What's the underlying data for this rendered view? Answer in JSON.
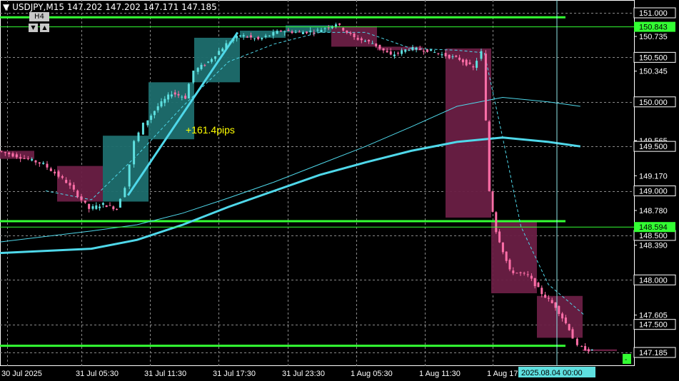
{
  "header": {
    "menu_glyph": "▼",
    "symbol_timeframe": "USDJPY,M15",
    "ohlc": "147.202 147.202 147.171 147.185"
  },
  "timeframe_badge": "H4",
  "timeframe_arrows": [
    "▼",
    "▲"
  ],
  "annotation": {
    "text": "+161.4pips",
    "color": "#ffff00"
  },
  "colors": {
    "background": "#000000",
    "bull_candle": "#5ee0e0",
    "bear_candle": "#ff6fa8",
    "h4_bull_box": "#1e6e6e",
    "h4_bear_box": "#6a1f45",
    "support_resistance": "#33ff33",
    "ma_slow": "#4fd8ea",
    "axis_text": "#ffffff"
  },
  "price_axis": {
    "ticks": [
      "151.000",
      "150.735",
      "150.500",
      "150.345",
      "150.000",
      "149.565",
      "149.500",
      "149.170",
      "149.000",
      "148.780",
      "148.500",
      "148.390",
      "148.000",
      "147.605",
      "147.500",
      "147.185"
    ],
    "boxed_ticks": [
      "151.000",
      "150.500",
      "150.000",
      "149.500",
      "149.000",
      "148.500",
      "148.000",
      "147.500",
      "147.185"
    ],
    "highlight_labels": [
      {
        "text": "150.843",
        "color": "#33ff33"
      },
      {
        "text": "148.594",
        "color": "#33ff33"
      }
    ],
    "current_price": "147.185",
    "corner_marker": "-"
  },
  "time_axis": {
    "labels": [
      "30 Jul 2025",
      "31 Jul 05:30",
      "31 Jul 11:30",
      "31 Jul 17:30",
      "31 Jul 23:30",
      "1 Aug 05:30",
      "1 Aug 11:30",
      "1 Aug 17"
    ],
    "crosshair_label": "2025.08.04 00:00"
  },
  "chart_data": {
    "type": "candlestick",
    "symbol": "USDJPY",
    "timeframe": "M15",
    "overlay_timeframe": "H4",
    "ylim": [
      147.05,
      151.05
    ],
    "horizontal_levels": [
      150.95,
      148.66,
      147.26
    ],
    "h4_boxes": [
      {
        "t0": 0.0,
        "t1": 0.75,
        "open": 149.45,
        "close": 149.36,
        "high": 149.5,
        "low": 149.05
      },
      {
        "t0": 1.25,
        "t1": 2.25,
        "open": 149.28,
        "close": 148.88,
        "high": 149.35,
        "low": 148.58
      },
      {
        "t0": 2.25,
        "t1": 3.25,
        "open": 148.88,
        "close": 149.62,
        "high": 149.68,
        "low": 148.72
      },
      {
        "t0": 3.25,
        "t1": 4.25,
        "open": 149.58,
        "close": 150.22,
        "high": 150.28,
        "low": 149.5
      },
      {
        "t0": 4.25,
        "t1": 5.25,
        "open": 150.22,
        "close": 150.72,
        "high": 150.78,
        "low": 150.15
      },
      {
        "t0": 5.25,
        "t1": 6.25,
        "open": 150.72,
        "close": 150.8,
        "high": 150.88,
        "low": 150.68
      },
      {
        "t0": 6.25,
        "t1": 7.25,
        "open": 150.78,
        "close": 150.86,
        "high": 150.93,
        "low": 150.72
      },
      {
        "t0": 7.25,
        "t1": 8.25,
        "open": 150.85,
        "close": 150.62,
        "high": 150.93,
        "low": 150.55
      },
      {
        "t0": 8.25,
        "t1": 9.25,
        "open": 150.62,
        "close": 150.58,
        "high": 150.68,
        "low": 150.42
      },
      {
        "t0": 9.75,
        "t1": 10.75,
        "open": 150.6,
        "close": 148.7,
        "high": 150.68,
        "low": 148.66
      },
      {
        "t0": 10.75,
        "t1": 11.75,
        "open": 148.66,
        "close": 147.85,
        "high": 148.72,
        "low": 147.55
      },
      {
        "t0": 11.75,
        "t1": 12.75,
        "open": 147.82,
        "close": 147.35,
        "high": 147.88,
        "low": 147.25
      },
      {
        "t0": 12.75,
        "t1": 13.5,
        "open": 147.22,
        "close": 147.2,
        "high": 147.24,
        "low": 147.18
      }
    ],
    "m15_path": [
      [
        0.0,
        149.45
      ],
      [
        0.5,
        149.38
      ],
      [
        1.0,
        149.3
      ],
      [
        1.5,
        149.1
      ],
      [
        2.0,
        148.8
      ],
      [
        2.3,
        148.85
      ],
      [
        2.6,
        148.8
      ],
      [
        2.8,
        149.05
      ],
      [
        3.0,
        149.55
      ],
      [
        3.2,
        149.75
      ],
      [
        3.5,
        149.95
      ],
      [
        3.8,
        150.1
      ],
      [
        4.1,
        150.05
      ],
      [
        4.3,
        150.35
      ],
      [
        4.6,
        150.45
      ],
      [
        5.0,
        150.65
      ],
      [
        5.3,
        150.75
      ],
      [
        5.7,
        150.7
      ],
      [
        6.2,
        150.8
      ],
      [
        6.6,
        150.78
      ],
      [
        7.0,
        150.8
      ],
      [
        7.4,
        150.88
      ],
      [
        7.8,
        150.72
      ],
      [
        8.2,
        150.66
      ],
      [
        8.6,
        150.52
      ],
      [
        9.0,
        150.6
      ],
      [
        9.4,
        150.58
      ],
      [
        9.8,
        150.52
      ],
      [
        10.1,
        150.48
      ],
      [
        10.4,
        150.38
      ],
      [
        10.6,
        150.56
      ],
      [
        10.75,
        149.0
      ],
      [
        10.9,
        148.55
      ],
      [
        11.2,
        148.1
      ],
      [
        11.6,
        148.05
      ],
      [
        11.9,
        147.85
      ],
      [
        12.2,
        147.7
      ],
      [
        12.5,
        147.45
      ],
      [
        12.7,
        147.25
      ],
      [
        13.0,
        147.2
      ]
    ],
    "ma_fast": [
      [
        1.0,
        149.0
      ],
      [
        2.0,
        148.9
      ],
      [
        3.0,
        149.4
      ],
      [
        4.0,
        149.95
      ],
      [
        5.0,
        150.45
      ],
      [
        6.0,
        150.65
      ],
      [
        7.0,
        150.78
      ],
      [
        8.0,
        150.78
      ],
      [
        9.0,
        150.6
      ],
      [
        10.0,
        150.58
      ],
      [
        10.6,
        150.55
      ],
      [
        11.0,
        149.6
      ],
      [
        11.4,
        148.6
      ],
      [
        12.0,
        147.95
      ],
      [
        12.8,
        147.6
      ]
    ],
    "ma_slow": [
      [
        -0.1,
        148.42
      ],
      [
        2.0,
        148.55
      ],
      [
        3.0,
        148.62
      ],
      [
        4.0,
        148.75
      ],
      [
        5.0,
        148.92
      ],
      [
        6.0,
        149.1
      ],
      [
        7.0,
        149.3
      ],
      [
        8.0,
        149.5
      ],
      [
        9.0,
        149.72
      ],
      [
        10.0,
        149.95
      ],
      [
        11.0,
        150.05
      ],
      [
        12.0,
        150.0
      ],
      [
        12.7,
        149.95
      ]
    ],
    "ma_slow_thick": [
      [
        -0.1,
        148.3
      ],
      [
        2.0,
        148.35
      ],
      [
        3.0,
        148.45
      ],
      [
        4.0,
        148.62
      ],
      [
        5.0,
        148.82
      ],
      [
        6.0,
        149.0
      ],
      [
        7.0,
        149.18
      ],
      [
        8.0,
        149.32
      ],
      [
        9.0,
        149.45
      ],
      [
        10.0,
        149.55
      ],
      [
        11.0,
        149.6
      ],
      [
        12.0,
        149.55
      ],
      [
        12.7,
        149.5
      ]
    ],
    "impulse_line": [
      [
        2.8,
        148.95
      ],
      [
        5.2,
        150.78
      ]
    ],
    "price_axis_ticks": [
      151.0,
      150.735,
      150.5,
      150.345,
      150.0,
      149.565,
      149.5,
      149.17,
      149.0,
      148.78,
      148.5,
      148.39,
      148.0,
      147.605,
      147.5,
      147.185
    ]
  }
}
